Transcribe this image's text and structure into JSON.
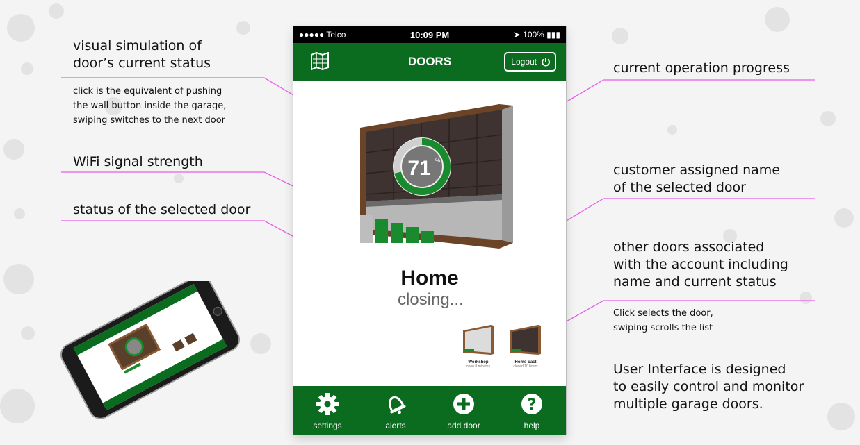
{
  "annotations": {
    "visual_sim_title_1": "visual simulation of",
    "visual_sim_title_2": "door’s current status",
    "visual_sim_desc_1": "click is the equivalent of pushing",
    "visual_sim_desc_2": "the wall button inside the garage,",
    "visual_sim_desc_3": "swiping switches to the next door",
    "wifi": "WiFi signal strength",
    "status": "status of the selected door",
    "progress": "current operation progress",
    "name_1": "customer assigned name",
    "name_2": "of the selected door",
    "others_1": "other doors associated",
    "others_2": "with the account including",
    "others_3": "name and current status",
    "others_desc_1": "Click selects the door,",
    "others_desc_2": "swiping scrolls the list",
    "ui_1": "User Interface is designed",
    "ui_2": "to easily control and monitor",
    "ui_3": "multiple garage doors."
  },
  "phone": {
    "status_bar": {
      "carrier": "●●●●● Telco",
      "time": "10:09 PM",
      "battery": "100%"
    },
    "topbar": {
      "title": "DOORS",
      "logout": "Logout"
    },
    "door": {
      "progress": "71",
      "progress_unit": "%",
      "progress_fraction": 0.71,
      "name": "Home",
      "status": "closing..."
    },
    "other_doors": [
      {
        "name": "Workshop",
        "status": "open 8 minutes"
      },
      {
        "name": "Home East",
        "status": "closed 10 hours"
      }
    ],
    "nav": [
      {
        "label": "settings",
        "icon": "gear-icon"
      },
      {
        "label": "alerts",
        "icon": "bell-icon"
      },
      {
        "label": "add door",
        "icon": "plus-icon"
      },
      {
        "label": "help",
        "icon": "question-icon"
      }
    ]
  },
  "colors": {
    "brand_green": "#0b6b1f",
    "signal_green": "#1a8a2e",
    "callout_line": "#e85ce8",
    "door_frame": "#8a5a34"
  }
}
